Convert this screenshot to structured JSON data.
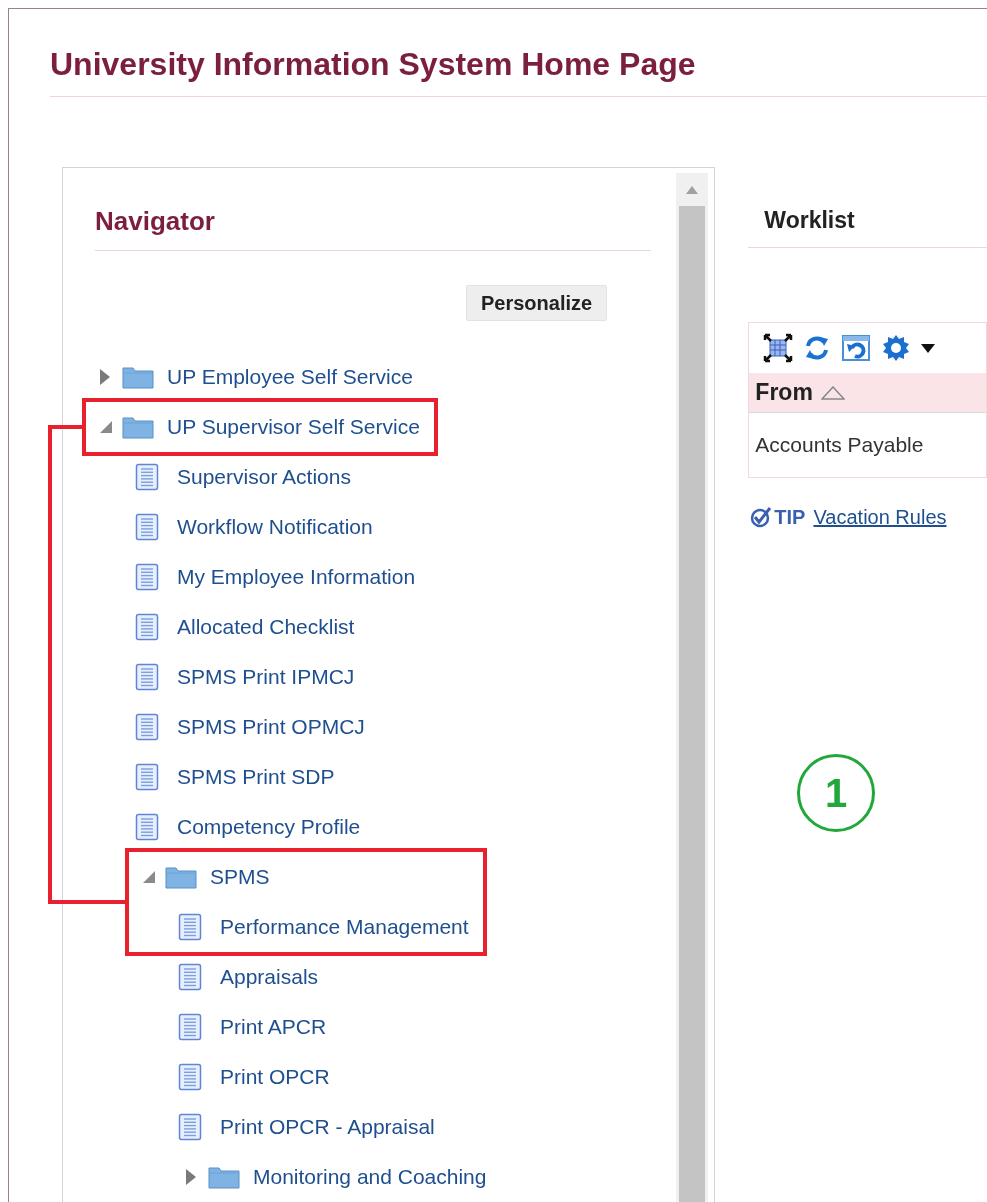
{
  "page_title": "University Information System Home Page",
  "navigator": {
    "title": "Navigator",
    "personalize_button": "Personalize",
    "tree": [
      {
        "kind": "folder",
        "label": "UP Employee Self Service",
        "expanded": false,
        "highlighted": false
      },
      {
        "kind": "folder",
        "label": "UP Supervisor Self Service",
        "expanded": true,
        "highlighted": true,
        "children": [
          {
            "kind": "page",
            "label": "Supervisor Actions",
            "highlighted": false
          },
          {
            "kind": "page",
            "label": "Workflow Notification",
            "highlighted": false
          },
          {
            "kind": "page",
            "label": "My Employee Information",
            "highlighted": false
          },
          {
            "kind": "page",
            "label": "Allocated Checklist",
            "highlighted": false
          },
          {
            "kind": "page",
            "label": "SPMS Print IPMCJ",
            "highlighted": false
          },
          {
            "kind": "page",
            "label": "SPMS Print OPMCJ",
            "highlighted": false
          },
          {
            "kind": "page",
            "label": "SPMS Print SDP",
            "highlighted": false
          },
          {
            "kind": "page",
            "label": "Competency Profile",
            "highlighted": false
          },
          {
            "kind": "folder",
            "label": "SPMS",
            "expanded": true,
            "highlighted": true,
            "children": [
              {
                "kind": "page",
                "label": "Performance Management",
                "highlighted": true
              },
              {
                "kind": "page",
                "label": "Appraisals",
                "highlighted": false
              },
              {
                "kind": "page",
                "label": "Print APCR",
                "highlighted": false
              },
              {
                "kind": "page",
                "label": "Print OPCR",
                "highlighted": false
              },
              {
                "kind": "page",
                "label": "Print OPCR - Appraisal",
                "highlighted": false
              },
              {
                "kind": "folder",
                "label": "Monitoring and Coaching",
                "expanded": false,
                "highlighted": false
              }
            ]
          }
        ]
      }
    ]
  },
  "worklist": {
    "title": "Worklist",
    "columns": [
      {
        "label": "From",
        "sorted_ascending": true
      }
    ],
    "rows": [
      [
        "Accounts Payable"
      ]
    ],
    "tip": {
      "label": "TIP",
      "link": "Vacation Rules"
    }
  },
  "step_badge": "1"
}
